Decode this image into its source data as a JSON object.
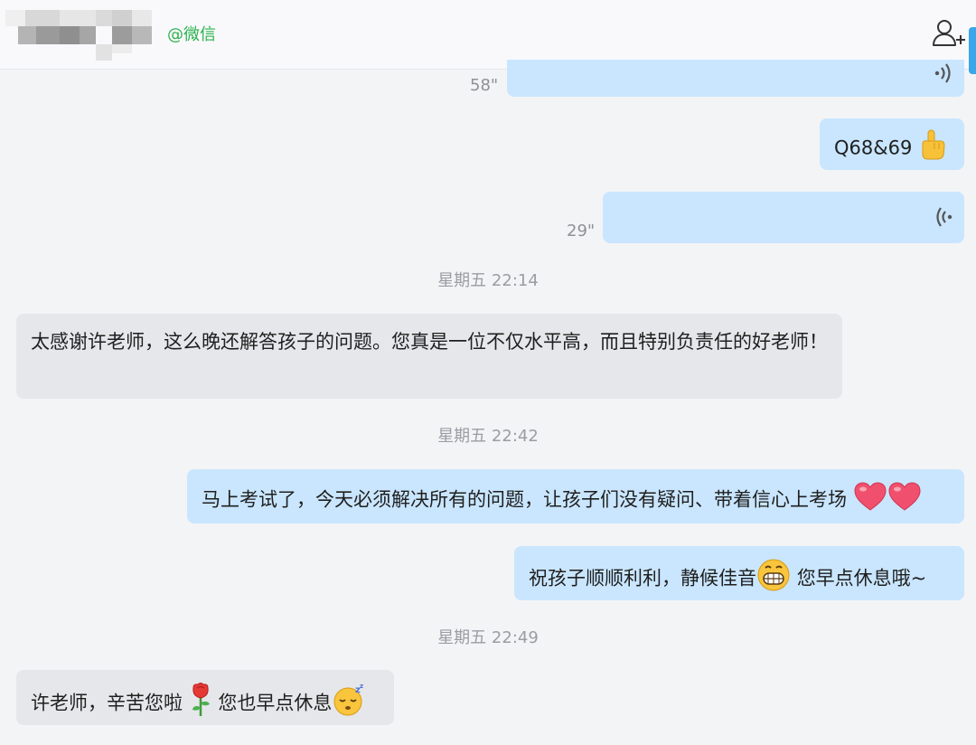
{
  "header": {
    "contact_handle": "@微信",
    "add_contact_icon": "add-person-icon"
  },
  "messages": {
    "voice_1": {
      "duration": "58\"",
      "icon": "voice-wave-icon"
    },
    "text_q": {
      "text": "Q68&69",
      "emoji": "pointing-up-hand"
    },
    "voice_2": {
      "duration": "29\"",
      "icon": "voice-wave-icon"
    },
    "time_1": "星期五 22:14",
    "text_thanks": "太感谢许老师，这么晚还解答孩子的问题。您真是一位不仅水平高，而且特别负责任的好老师！",
    "time_2": "星期五 22:42",
    "text_exam": {
      "text": "马上考试了，今天必须解决所有的问题，让孩子们没有疑问、带着信心上考场",
      "emoji": "heart x2"
    },
    "text_wish": {
      "text_before": "祝孩子顺顺利利，静候佳音",
      "text_after": "您早点休息哦~",
      "emoji": "grinning-face"
    },
    "time_3": "星期五 22:49",
    "text_reply": {
      "text_before": "许老师，辛苦您啦",
      "text_after": "您也早点休息",
      "emoji": [
        "rose",
        "sleeping-face"
      ]
    }
  },
  "colors": {
    "outgoing_bubble": "#c9e6fe",
    "incoming_bubble": "#e5e7ea",
    "handle_green": "#2bb24c",
    "accent_blue": "#3aa7ea"
  }
}
